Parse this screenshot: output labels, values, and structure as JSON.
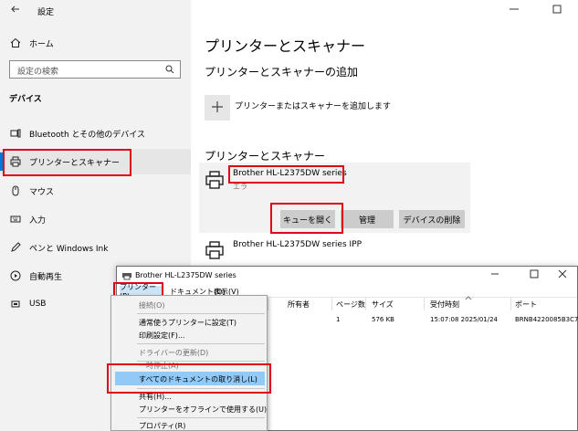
{
  "window": {
    "title": "設定"
  },
  "sidebar": {
    "home": "ホーム",
    "search_placeholder": "設定の検索",
    "section": "デバイス",
    "items": [
      {
        "label": "Bluetooth とその他のデバイス",
        "icon": "bluetooth-device-icon"
      },
      {
        "label": "プリンターとスキャナー",
        "icon": "printer-icon"
      },
      {
        "label": "マウス",
        "icon": "mouse-icon"
      },
      {
        "label": "入力",
        "icon": "keyboard-icon"
      },
      {
        "label": "ペンと Windows Ink",
        "icon": "pen-icon"
      },
      {
        "label": "自動再生",
        "icon": "autoplay-icon"
      },
      {
        "label": "USB",
        "icon": "usb-icon"
      }
    ]
  },
  "main": {
    "title": "プリンターとスキャナー",
    "add_section": "プリンターとスキャナーの追加",
    "add_label": "プリンターまたはスキャナーを追加します",
    "list_section": "プリンターとスキャナー",
    "printers": [
      {
        "name": "Brother HL-L2375DW series",
        "status": "エラ"
      },
      {
        "name": "Brother HL-L2375DW series IPP"
      }
    ],
    "buttons": {
      "queue": "キューを開く",
      "manage": "管理",
      "remove": "デバイスの削除"
    }
  },
  "queue_window": {
    "title": "Brother HL-L2375DW series",
    "menus": [
      "プリンター(P)",
      "ドキュメント(D)",
      "表示(V)"
    ],
    "columns": [
      "所有者",
      "ページ数",
      "サイズ",
      "受付時刻",
      "ポート"
    ],
    "row": {
      "pages": "1",
      "size": "576 KB",
      "time": "15:07:08  2025/01/24",
      "port": "BRNB4220085B3C7"
    }
  },
  "menu": {
    "items": [
      {
        "label": "接続(O)",
        "disabled": true
      },
      {
        "label": "通常使うプリンターに設定(T)",
        "disabled": false
      },
      {
        "label": "印刷設定(F)...",
        "disabled": false
      },
      {
        "label": "ドライバーの更新(D)",
        "disabled": true
      },
      {
        "label": "一時停止(A)",
        "disabled": true
      },
      {
        "label": "すべてのドキュメントの取り消し(L)",
        "disabled": false,
        "highlighted": true
      },
      {
        "label": "共有(H)...",
        "disabled": false
      },
      {
        "label": "プリンターをオフラインで使用する(U)",
        "disabled": false
      },
      {
        "label": "プロパティ(R)",
        "disabled": false
      }
    ]
  },
  "colors": {
    "highlight": "#e0001a",
    "accent": "#0078d7",
    "menu_highlight": "#91c9f7"
  }
}
